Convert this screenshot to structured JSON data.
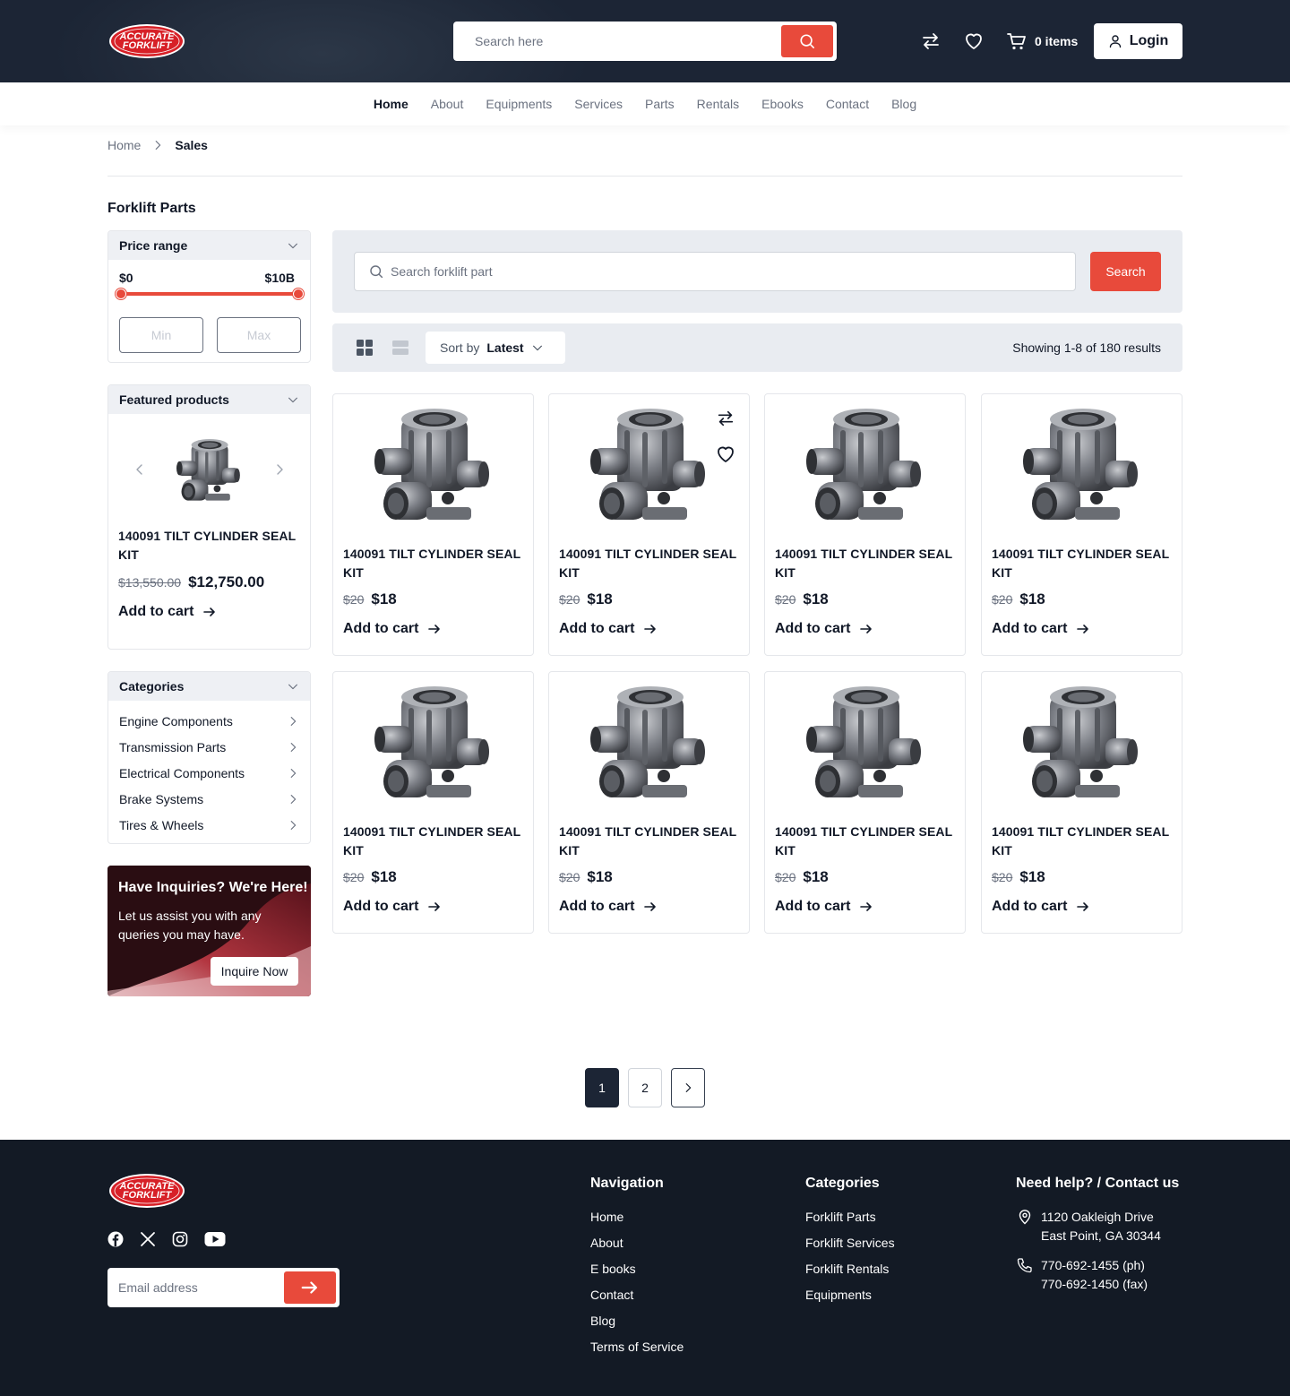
{
  "header": {
    "logo_text": "ACCURATE FORKLIFT",
    "search_placeholder": "Search here",
    "cart_label": "0 items",
    "login_label": "Login"
  },
  "nav": {
    "items": [
      "Home",
      "About",
      "Equipments",
      "Services",
      "Parts",
      "Rentals",
      "Ebooks",
      "Contact",
      "Blog"
    ],
    "active": "Home"
  },
  "breadcrumb": {
    "home": "Home",
    "current": "Sales"
  },
  "page_title": "Forklift Parts",
  "sidebar": {
    "price_range": {
      "title": "Price range",
      "min_label": "$0",
      "max_label": "$10B",
      "min_placeholder": "Min",
      "max_placeholder": "Max"
    },
    "featured": {
      "title": "Featured products",
      "name": "140091 TILT CYLINDER SEAL KIT",
      "old_price": "$13,550.00",
      "price": "$12,750.00",
      "add_to_cart": "Add to cart"
    },
    "categories": {
      "title": "Categories",
      "items": [
        "Engine Components",
        "Transmission Parts",
        "Electrical Components",
        "Brake Systems",
        "Tires & Wheels"
      ]
    },
    "promo": {
      "title": "Have Inquiries? We're Here!",
      "text": "Let us assist you with any queries you may have.",
      "button": "Inquire Now"
    }
  },
  "search_panel": {
    "placeholder": "Search forklift part",
    "button": "Search"
  },
  "toolbar": {
    "sort_prefix": "Sort by",
    "sort_value": "Latest",
    "showing": "Showing 1-8 of 180 results"
  },
  "products": [
    {
      "name": "140091 TILT CYLINDER SEAL KIT",
      "old_price": "$20",
      "price": "$18",
      "add_to_cart": "Add to cart"
    },
    {
      "name": "140091 TILT CYLINDER SEAL KIT",
      "old_price": "$20",
      "price": "$18",
      "add_to_cart": "Add to cart"
    },
    {
      "name": "140091 TILT CYLINDER SEAL KIT",
      "old_price": "$20",
      "price": "$18",
      "add_to_cart": "Add to cart"
    },
    {
      "name": "140091 TILT CYLINDER SEAL KIT",
      "old_price": "$20",
      "price": "$18",
      "add_to_cart": "Add to cart"
    },
    {
      "name": "140091 TILT CYLINDER SEAL KIT",
      "old_price": "$20",
      "price": "$18",
      "add_to_cart": "Add to cart"
    },
    {
      "name": "140091 TILT CYLINDER SEAL KIT",
      "old_price": "$20",
      "price": "$18",
      "add_to_cart": "Add to cart"
    },
    {
      "name": "140091 TILT CYLINDER SEAL KIT",
      "old_price": "$20",
      "price": "$18",
      "add_to_cart": "Add to cart"
    },
    {
      "name": "140091 TILT CYLINDER SEAL KIT",
      "old_price": "$20",
      "price": "$18",
      "add_to_cart": "Add to cart"
    }
  ],
  "pagination": {
    "pages": [
      "1",
      "2"
    ],
    "current": "1"
  },
  "footer": {
    "email_placeholder": "Email address",
    "navigation": {
      "title": "Navigation",
      "items": [
        "Home",
        "About",
        "E books",
        "Contact",
        "Blog",
        "Terms of Service"
      ]
    },
    "categories": {
      "title": "Categories",
      "items": [
        "Forklift Parts",
        "Forklift Services",
        "Forklift Rentals",
        "Equipments"
      ]
    },
    "contact": {
      "title": "Need help? / Contact us",
      "address_line1": "1120 Oakleigh Drive",
      "address_line2": "East Point, GA 30344",
      "phone": "770-692-1455 (ph)",
      "fax": "770-692-1450 (fax)"
    }
  },
  "colors": {
    "accent": "#e84a3b",
    "header_bg": "#1c2535",
    "footer_bg": "#131a25"
  },
  "icons": [
    "compare-icon",
    "heart-icon",
    "cart-icon",
    "user-icon",
    "search-icon",
    "chevron-down-icon",
    "chevron-right-icon",
    "grid-view-icon",
    "list-view-icon",
    "arrow-right-icon",
    "facebook-icon",
    "x-icon",
    "instagram-icon",
    "youtube-icon",
    "location-icon",
    "phone-icon"
  ]
}
